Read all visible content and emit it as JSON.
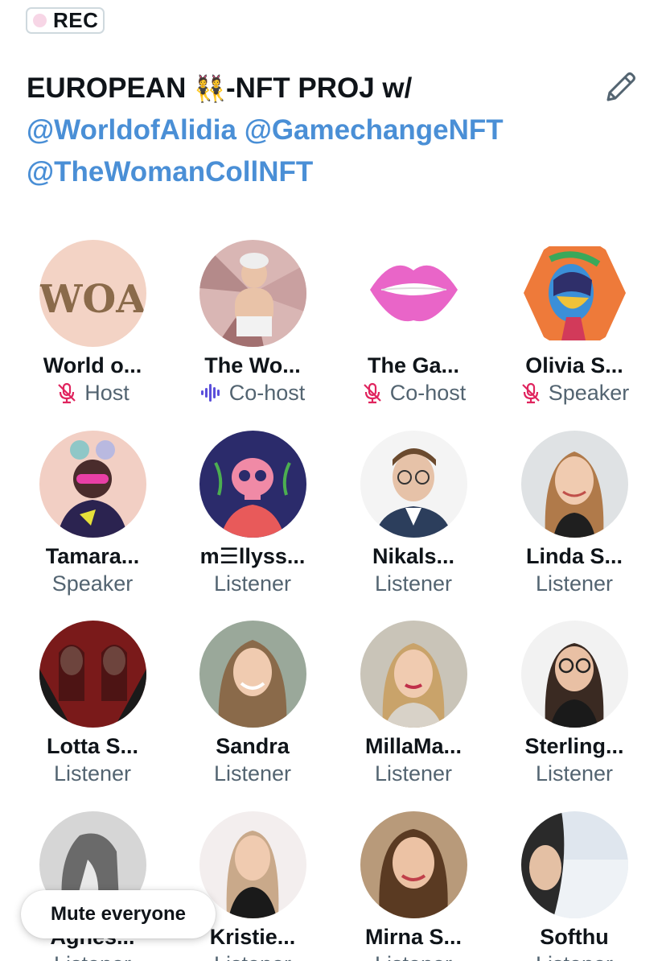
{
  "rec_badge": {
    "label": "REC"
  },
  "title": {
    "line1_a": "EUROPEAN ",
    "line1_emoji": "👯",
    "line1_b": "-NFT PROJ w/",
    "mention1": "@WorldofAlidia",
    "mention2": "@GamechangeNFT",
    "mention3": "@TheWomanCollNFT"
  },
  "participants": [
    {
      "name": "World o...",
      "role": "Host",
      "icon": "mic-muted-icon"
    },
    {
      "name": "The Wo...",
      "role": "Co-host",
      "icon": "speaking-wave-icon"
    },
    {
      "name": "The Ga...",
      "role": "Co-host",
      "icon": "mic-muted-icon"
    },
    {
      "name": "Olivia S...",
      "role": "Speaker",
      "icon": "mic-muted-icon"
    },
    {
      "name": "Tamara...",
      "role": "Speaker",
      "icon": ""
    },
    {
      "name": "m☰llyss...",
      "role": "Listener",
      "icon": ""
    },
    {
      "name": "Nikals...",
      "role": "Listener",
      "icon": ""
    },
    {
      "name": "Linda S...",
      "role": "Listener",
      "icon": ""
    },
    {
      "name": "Lotta S...",
      "role": "Listener",
      "icon": ""
    },
    {
      "name": "Sandra",
      "role": "Listener",
      "icon": ""
    },
    {
      "name": "MillaMa...",
      "role": "Listener",
      "icon": ""
    },
    {
      "name": "Sterling...",
      "role": "Listener",
      "icon": ""
    },
    {
      "name": "Agnes...",
      "role": "Listener",
      "icon": ""
    },
    {
      "name": "Kristie...",
      "role": "Listener",
      "icon": ""
    },
    {
      "name": "Mirna S...",
      "role": "Listener",
      "icon": ""
    },
    {
      "name": "Softhu",
      "role": "Listener",
      "icon": ""
    }
  ],
  "avatar_art": {
    "woa_text": "WOA"
  },
  "mute_button": {
    "label": "Mute everyone"
  },
  "colors": {
    "mention": "#4a8fd6",
    "muted_mic": "#e0245e",
    "speaking": "#5b4fdb",
    "role_text": "#536471"
  }
}
